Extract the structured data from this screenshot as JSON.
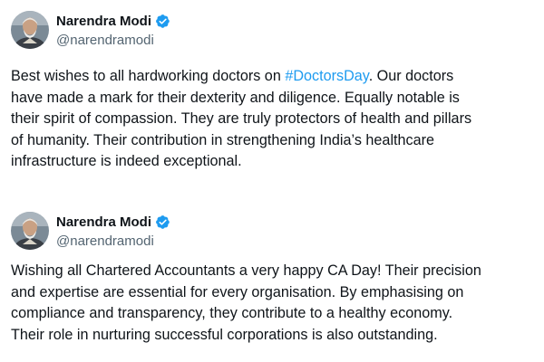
{
  "tweets": [
    {
      "author": {
        "name": "Narendra Modi",
        "handle": "@narendramodi",
        "verified": true,
        "verified_color": "#1d9bf0",
        "avatar_icon": "avatar-photo"
      },
      "lines": [
        {
          "before": "Best wishes to all hardworking doctors on ",
          "hashtag": "#DoctorsDay",
          "after": ". Our doctors"
        },
        {
          "text": "have made a mark for their dexterity and diligence. Equally notable is"
        },
        {
          "text": "their spirit of compassion. They are truly protectors of health and pillars"
        },
        {
          "text": "of humanity. Their contribution in strengthening India’s healthcare"
        },
        {
          "text": "infrastructure is indeed exceptional."
        }
      ]
    },
    {
      "author": {
        "name": "Narendra Modi",
        "handle": "@narendramodi",
        "verified": true,
        "verified_color": "#1d9bf0",
        "avatar_icon": "avatar-photo"
      },
      "lines": [
        {
          "text": "Wishing all Chartered Accountants a very happy CA Day! Their precision"
        },
        {
          "text": "and expertise are essential for every organisation. By emphasising on"
        },
        {
          "text": "compliance and transparency, they contribute to a healthy economy."
        },
        {
          "text": "Their role in nurturing successful corporations is also outstanding."
        }
      ]
    }
  ],
  "colors": {
    "text": "#0f1419",
    "secondary": "#536471",
    "link": "#1d9bf0",
    "background": "#ffffff"
  }
}
